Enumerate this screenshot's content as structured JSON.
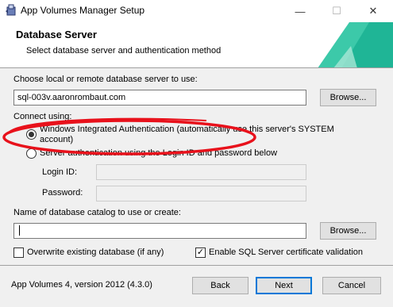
{
  "window": {
    "title": "App Volumes Manager Setup",
    "minimize_glyph": "—",
    "maximize_glyph": "☐",
    "close_glyph": "✕"
  },
  "banner": {
    "title": "Database Server",
    "subtitle": "Select database server and authentication method"
  },
  "server": {
    "label": "Choose local or remote database server to use:",
    "value": "sql-003v.aaronrombaut.com",
    "browse_label": "Browse..."
  },
  "connect": {
    "label": "Connect using:",
    "windows_auth_line1": "Windows Integrated Authentication (automatically use this server's SYSTEM",
    "windows_auth_line2": "account)",
    "windows_auth_selected": true,
    "sql_auth": "Server authentication using the Login ID and password below",
    "sql_auth_selected": false,
    "login_label": "Login ID:",
    "login_value": "",
    "password_label": "Password:",
    "password_value": ""
  },
  "catalog": {
    "label": "Name of database catalog to use or create:",
    "value": "",
    "browse_label": "Browse..."
  },
  "options": {
    "overwrite_label": "Overwrite existing database (if any)",
    "overwrite_checked": false,
    "ssl_label": "Enable SQL Server certificate validation",
    "ssl_checked": true
  },
  "footer": {
    "version": "App Volumes 4, version 2012 (4.3.0)",
    "back_label": "Back",
    "next_label": "Next",
    "cancel_label": "Cancel"
  },
  "colors": {
    "accent": "#0078d7",
    "banner_teal": "#3cc9a9",
    "annotation_red": "#e8111b"
  }
}
